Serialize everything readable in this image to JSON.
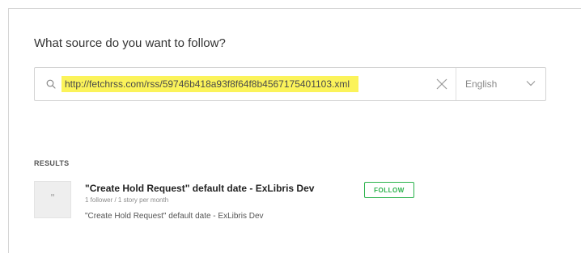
{
  "heading": "What source do you want to follow?",
  "search": {
    "value": "http://fetchrss.com/rss/59746b418a93f8f64f8b4567175401103.xml",
    "icon": "search-icon",
    "clear_icon": "close-icon",
    "highlight_color": "#fbf35a"
  },
  "language": {
    "selected": "English",
    "icon": "chevron-down-icon"
  },
  "results": {
    "label": "RESULTS",
    "items": [
      {
        "thumb_glyph": "\"",
        "title": "\"Create Hold Request\" default date - ExLibris Dev",
        "meta": "1 follower / 1 story per month",
        "description": "\"Create Hold Request\" default date - ExLibris Dev",
        "follow_label": "FOLLOW"
      }
    ]
  },
  "colors": {
    "accent": "#2bb24c"
  }
}
